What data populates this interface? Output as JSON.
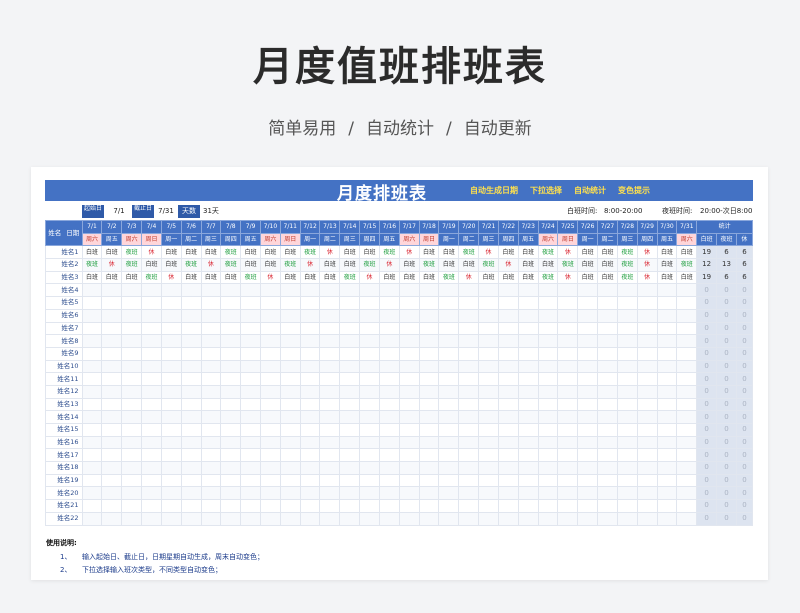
{
  "hero": {
    "title": "月度值班排班表",
    "tag1": "简单易用",
    "tag2": "自动统计",
    "tag3": "自动更新",
    "sep": "/"
  },
  "banner": {
    "title": "月度排班表",
    "tags": [
      "自动生成日期",
      "下拉选择",
      "自动统计",
      "变色提示"
    ]
  },
  "info": {
    "start_label": "起始日",
    "start_value": "7/1",
    "end_label": "截止日",
    "end_value": "7/31",
    "days_label": "天数",
    "days_value": "31天",
    "day_shift_label": "白班时间:",
    "day_shift_value": "8:00-20:00",
    "night_shift_label": "夜班时间:",
    "night_shift_value": "20:00-次日8:00"
  },
  "header": {
    "corner_name": "姓名",
    "corner_date": "日期",
    "stats_title": "统计",
    "stats_cols": [
      "白班",
      "夜班",
      "休"
    ],
    "dates": [
      "7/1",
      "7/2",
      "7/3",
      "7/4",
      "7/5",
      "7/6",
      "7/7",
      "7/8",
      "7/9",
      "7/10",
      "7/11",
      "7/12",
      "7/13",
      "7/14",
      "7/15",
      "7/16",
      "7/17",
      "7/18",
      "7/19",
      "7/20",
      "7/21",
      "7/22",
      "7/23",
      "7/24",
      "7/25",
      "7/26",
      "7/27",
      "7/28",
      "7/29",
      "7/30",
      "7/31"
    ],
    "weekdays": [
      "周六",
      "周五",
      "周六",
      "周日",
      "周一",
      "周二",
      "周三",
      "周四",
      "周五",
      "周六",
      "周日",
      "周一",
      "周二",
      "周三",
      "周四",
      "周五",
      "周六",
      "周日",
      "周一",
      "周二",
      "周三",
      "周四",
      "周五",
      "周六",
      "周日",
      "周一",
      "周二",
      "周三",
      "周四",
      "周五",
      "周六"
    ]
  },
  "shift_codes": {
    "D": "白班",
    "N": "夜班",
    "O": "休"
  },
  "rows": [
    {
      "name": "姓名1",
      "shifts": "DDNODDDNDDDNODDNODDNODDNODDNODD",
      "stats": [
        "19",
        "6",
        "6"
      ]
    },
    {
      "name": "姓名2",
      "shifts": "NONDDNONDDNODDNODNDDNODDNDDNODN",
      "stats": [
        "12",
        "13",
        "6"
      ]
    },
    {
      "name": "姓名3",
      "shifts": "DDDNODDDNODDDNODDDNODDDNODDNODD",
      "stats": [
        "19",
        "6",
        "6"
      ]
    },
    {
      "name": "姓名4",
      "shifts": "",
      "stats": [
        "0",
        "0",
        "0"
      ]
    },
    {
      "name": "姓名5",
      "shifts": "",
      "stats": [
        "0",
        "0",
        "0"
      ]
    },
    {
      "name": "姓名6",
      "shifts": "",
      "stats": [
        "0",
        "0",
        "0"
      ]
    },
    {
      "name": "姓名7",
      "shifts": "",
      "stats": [
        "0",
        "0",
        "0"
      ]
    },
    {
      "name": "姓名8",
      "shifts": "",
      "stats": [
        "0",
        "0",
        "0"
      ]
    },
    {
      "name": "姓名9",
      "shifts": "",
      "stats": [
        "0",
        "0",
        "0"
      ]
    },
    {
      "name": "姓名10",
      "shifts": "",
      "stats": [
        "0",
        "0",
        "0"
      ]
    },
    {
      "name": "姓名11",
      "shifts": "",
      "stats": [
        "0",
        "0",
        "0"
      ]
    },
    {
      "name": "姓名12",
      "shifts": "",
      "stats": [
        "0",
        "0",
        "0"
      ]
    },
    {
      "name": "姓名13",
      "shifts": "",
      "stats": [
        "0",
        "0",
        "0"
      ]
    },
    {
      "name": "姓名14",
      "shifts": "",
      "stats": [
        "0",
        "0",
        "0"
      ]
    },
    {
      "name": "姓名15",
      "shifts": "",
      "stats": [
        "0",
        "0",
        "0"
      ]
    },
    {
      "name": "姓名16",
      "shifts": "",
      "stats": [
        "0",
        "0",
        "0"
      ]
    },
    {
      "name": "姓名17",
      "shifts": "",
      "stats": [
        "0",
        "0",
        "0"
      ]
    },
    {
      "name": "姓名18",
      "shifts": "",
      "stats": [
        "0",
        "0",
        "0"
      ]
    },
    {
      "name": "姓名19",
      "shifts": "",
      "stats": [
        "0",
        "0",
        "0"
      ]
    },
    {
      "name": "姓名20",
      "shifts": "",
      "stats": [
        "0",
        "0",
        "0"
      ]
    },
    {
      "name": "姓名21",
      "shifts": "",
      "stats": [
        "0",
        "0",
        "0"
      ]
    },
    {
      "name": "姓名22",
      "shifts": "",
      "stats": [
        "0",
        "0",
        "0"
      ]
    }
  ],
  "notes": {
    "title": "使用说明:",
    "items": [
      {
        "num": "1、",
        "text": "输入起始日、截止日，日期星期自动生成，周末自动变色；"
      },
      {
        "num": "2、",
        "text": "下拉选择输入班次类型，不同类型自动变色；"
      }
    ]
  },
  "colors": {
    "header_blue": "#4472c4",
    "weekend_pink": "#ffd6da",
    "night_green": "#1a9c3a",
    "off_red": "#d9232e",
    "tag_yellow": "#ffe14d"
  }
}
